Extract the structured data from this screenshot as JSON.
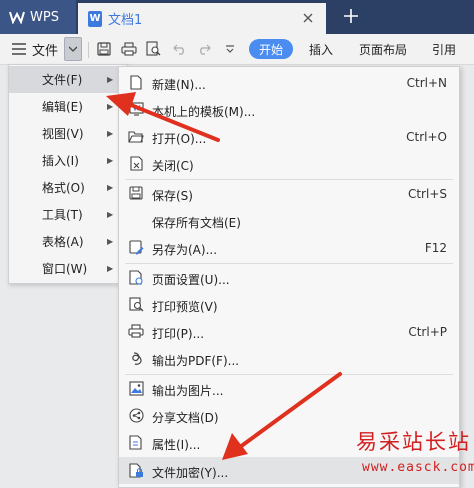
{
  "tabs": {
    "app_name": "WPS",
    "document_name": "文档1"
  },
  "toolbar": {
    "menu_label": "文件",
    "start_label": "开始",
    "ribbon_tabs": [
      "插入",
      "页面布局",
      "引用"
    ]
  },
  "main_menu": {
    "items": [
      {
        "label": "文件(F)",
        "active": true
      },
      {
        "label": "编辑(E)"
      },
      {
        "label": "视图(V)"
      },
      {
        "label": "插入(I)"
      },
      {
        "label": "格式(O)"
      },
      {
        "label": "工具(T)"
      },
      {
        "label": "表格(A)"
      },
      {
        "label": "窗口(W)"
      }
    ]
  },
  "file_menu": {
    "items": [
      {
        "label": "新建(N)...",
        "shortcut": "Ctrl+N",
        "icon": "new-doc-icon"
      },
      {
        "label": "本机上的模板(M)...",
        "shortcut": "",
        "icon": "template-icon"
      },
      {
        "label": "打开(O)...",
        "shortcut": "Ctrl+O",
        "icon": "open-folder-icon"
      },
      {
        "label": "关闭(C)",
        "shortcut": "",
        "icon": "close-doc-icon"
      },
      {
        "label": "保存(S)",
        "shortcut": "Ctrl+S",
        "icon": "save-icon"
      },
      {
        "label": "保存所有文档(E)",
        "shortcut": "",
        "icon": ""
      },
      {
        "label": "另存为(A)...",
        "shortcut": "F12",
        "icon": "save-as-icon"
      },
      {
        "label": "页面设置(U)...",
        "shortcut": "",
        "icon": "page-setup-icon"
      },
      {
        "label": "打印预览(V)",
        "shortcut": "",
        "icon": "print-preview-icon"
      },
      {
        "label": "打印(P)...",
        "shortcut": "Ctrl+P",
        "icon": "print-icon"
      },
      {
        "label": "输出为PDF(F)...",
        "shortcut": "",
        "icon": "pdf-export-icon"
      },
      {
        "label": "输出为图片...",
        "shortcut": "",
        "icon": "image-export-icon"
      },
      {
        "label": "分享文档(D)",
        "shortcut": "",
        "icon": "share-icon"
      },
      {
        "label": "属性(I)...",
        "shortcut": "",
        "icon": "properties-icon"
      },
      {
        "label": "文件加密(Y)...",
        "shortcut": "",
        "icon": "encrypt-icon",
        "hover": true
      }
    ]
  },
  "watermark": {
    "title": "易采站长站",
    "url": "www.easck.com"
  },
  "colors": {
    "accent": "#4a8cf0",
    "tabbar": "#2c3f64",
    "annotation_red": "#e0301e"
  }
}
